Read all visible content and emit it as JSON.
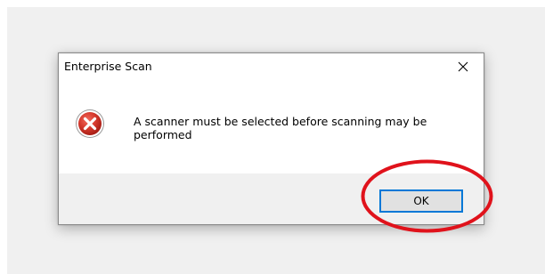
{
  "dialog": {
    "title": "Enterprise Scan",
    "message": "A scanner must be selected before scanning may be performed",
    "ok_label": "OK",
    "icon": "error-icon",
    "close_icon": "close-icon"
  },
  "annotation": {
    "shape": "ellipse",
    "color": "#e0121b",
    "target": "ok-button"
  },
  "colors": {
    "dialog_background": "#ffffff",
    "footer_background": "#f0f0f0",
    "button_focus_border": "#0078d7",
    "error_icon": "#c42b1c"
  }
}
